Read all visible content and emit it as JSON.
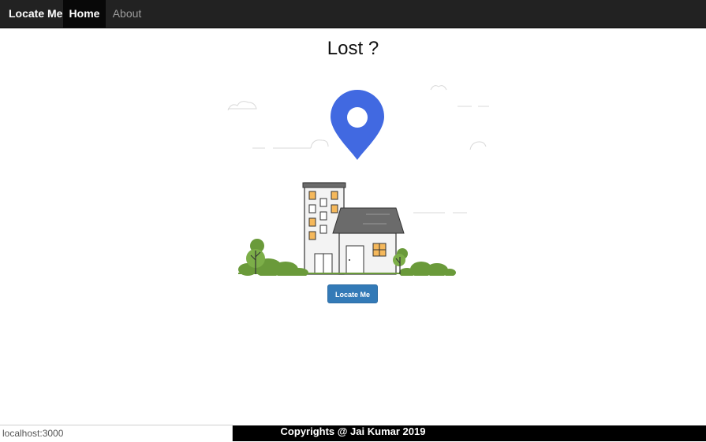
{
  "navbar": {
    "brand": "Locate Me",
    "items": [
      {
        "label": "Home",
        "active": true
      },
      {
        "label": "About",
        "active": false
      }
    ],
    "background": "#222222"
  },
  "main": {
    "title": "Lost ?",
    "illustration": [
      "location-pin-icon",
      "apartment-building",
      "house",
      "tree",
      "bush",
      "cloud"
    ],
    "pin_color": "#4169e1",
    "button_label": "Locate Me",
    "button_color": "#337ab7"
  },
  "footer": {
    "text": "Copyrights @ Jai Kumar 2019"
  },
  "status_bar": {
    "url": "localhost:3000"
  }
}
